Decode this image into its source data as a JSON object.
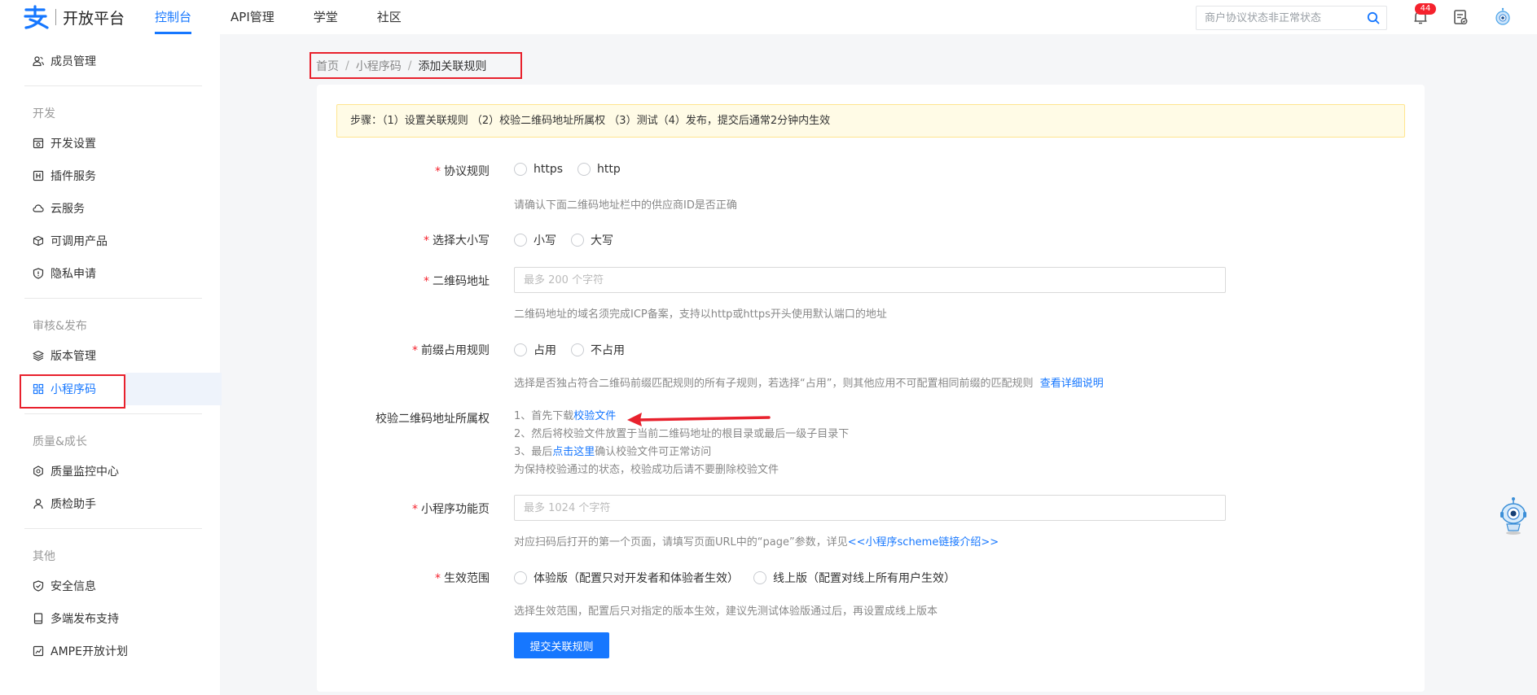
{
  "header": {
    "brand": "开放平台",
    "nav": [
      "控制台",
      "API管理",
      "学堂",
      "社区"
    ],
    "search_placeholder": "商户协议状态非正常状态",
    "notification_count": "44",
    "accent": "#1677ff"
  },
  "sidebar": {
    "top_item": "成员管理",
    "sections": [
      {
        "title": "开发",
        "items": [
          "开发设置",
          "插件服务",
          "云服务",
          "可调用产品",
          "隐私申请"
        ]
      },
      {
        "title": "审核&发布",
        "items": [
          "版本管理",
          "小程序码"
        ]
      },
      {
        "title": "质量&成长",
        "items": [
          "质量监控中心",
          "质检助手"
        ]
      },
      {
        "title": "其他",
        "items": [
          "安全信息",
          "多端发布支持",
          "AMPE开放计划"
        ]
      }
    ]
  },
  "breadcrumb": [
    "首页",
    "小程序码",
    "添加关联规则"
  ],
  "steps_banner": "步骤：（1）设置关联规则 （2）校验二维码地址所属权 （3）测试（4）发布，提交后通常2分钟内生效",
  "form": {
    "protocol": {
      "label": "协议规则",
      "options": [
        "https",
        "http"
      ],
      "help": "请确认下面二维码地址栏中的供应商ID是否正确"
    },
    "case": {
      "label": "选择大小写",
      "options": [
        "小写",
        "大写"
      ]
    },
    "qr_address": {
      "label": "二维码地址",
      "placeholder": "最多 200 个字符",
      "help": "二维码地址的域名须完成ICP备案，支持以http或https开头使用默认端口的地址"
    },
    "prefix": {
      "label": "前缀占用规则",
      "options": [
        "占用",
        "不占用"
      ],
      "help": "选择是否独占符合二维码前缀匹配规则的所有子规则，若选择“占用”，则其他应用不可配置相同前缀的匹配规则",
      "help_link": "查看详细说明"
    },
    "verify": {
      "label": "校验二维码地址所属权",
      "line1_prefix": "1、首先下载",
      "line1_link": "校验文件",
      "line2": "2、然后将校验文件放置于当前二维码地址的根目录或最后一级子目录下",
      "line3_prefix": "3、最后",
      "line3_link": "点击这里",
      "line3_suffix": "确认校验文件可正常访问",
      "line4": "为保持校验通过的状态，校验成功后请不要删除校验文件"
    },
    "page": {
      "label": "小程序功能页",
      "placeholder": "最多 1024 个字符",
      "help": "对应扫码后打开的第一个页面，请填写页面URL中的“page”参数，详见",
      "help_link": "<<小程序scheme链接介绍>>"
    },
    "scope": {
      "label": "生效范围",
      "options": [
        "体验版（配置只对开发者和体验者生效）",
        "线上版（配置对线上所有用户生效）"
      ],
      "help": "选择生效范围，配置后只对指定的版本生效，建议先测试体验版通过后，再设置成线上版本"
    },
    "submit_label": "提交关联规则"
  }
}
